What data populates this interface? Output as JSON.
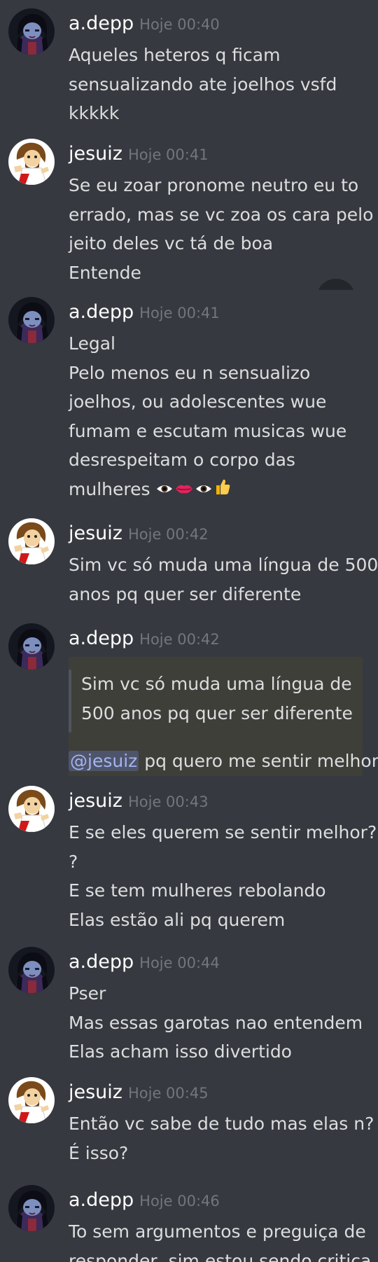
{
  "users": {
    "adepp": "a.depp",
    "jesuiz": "jesuiz"
  },
  "messages": [
    {
      "user": "a.depp",
      "time": "Hoje 00:40",
      "lines": [
        "Aqueles heteros q ficam",
        "sensualizando ate joelhos vsfd",
        "kkkkk"
      ]
    },
    {
      "user": "jesuiz",
      "time": "Hoje 00:41",
      "lines": [
        "Se eu zoar pronome neutro eu to",
        "errado, mas se vc zoa os cara pelo",
        "jeito deles vc tá de boa",
        "Entende"
      ]
    },
    {
      "user": "a.depp",
      "time": "Hoje 00:41",
      "lines": [
        "Legal",
        "Pelo menos eu n sensualizo",
        "joelhos, ou adolescentes wue",
        "fumam e escutam musicas wue",
        "desrespeitam o corpo das",
        "mulheres"
      ]
    },
    {
      "user": "jesuiz",
      "time": "Hoje 00:42",
      "lines": [
        "Sim vc só muda uma língua de 500",
        "anos pq quer ser diferente"
      ]
    },
    {
      "user": "a.depp",
      "time": "Hoje 00:42",
      "quote": [
        "Sim vc só muda uma língua de",
        "500 anos pq quer ser diferente"
      ],
      "mention": "@jesuiz",
      "reply": " pq quero me sentir melhor"
    },
    {
      "user": "jesuiz",
      "time": "Hoje 00:43",
      "lines": [
        "E se eles querem se sentir melhor?",
        "?",
        "E se tem mulheres rebolando",
        "Elas estão ali pq querem"
      ]
    },
    {
      "user": "a.depp",
      "time": "Hoje 00:44",
      "lines": [
        "Pser",
        "Mas essas garotas nao entendem",
        "Elas acham isso divertido"
      ]
    },
    {
      "user": "jesuiz",
      "time": "Hoje 00:45",
      "lines": [
        "Então vc sabe de tudo mas elas n?",
        "É isso?"
      ]
    },
    {
      "user": "a.depp",
      "time": "Hoje 00:46",
      "lines": [
        "To sem argumentos e preguiça de",
        "responder,  sim estou sendo critica"
      ]
    }
  ],
  "emoji": [
    "eye-emoji",
    "lips-emoji",
    "eye-emoji",
    "thumbs-up-emoji"
  ],
  "colors": {
    "background": "#36393f",
    "username": "#ffffff",
    "timestamp": "#72767d",
    "text": "#dcddde",
    "mention": "#a5b3f0",
    "highlight": "#3f3f3a"
  }
}
